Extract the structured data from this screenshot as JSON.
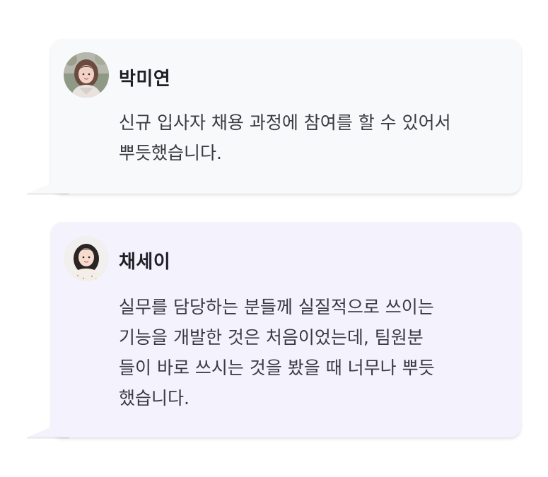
{
  "testimonials": [
    {
      "name": "박미연",
      "lines": [
        "신규 입사자 채용 과정에 참여를 할 수 있어서",
        "뿌듯했습니다."
      ],
      "background": "#f8f9fb"
    },
    {
      "name": "채세이",
      "lines": [
        "실무를 담당하는 분들께 실질적으로 쓰이는",
        "기능을 개발한 것은 처음이었는데, 팀원분",
        "들이 바로 쓰시는 것을 봤을 때 너무나 뿌듯",
        "했습니다."
      ],
      "background": "#f4f2fd"
    }
  ],
  "icons": {
    "avatar_1": "avatar-photo-icon",
    "avatar_2": "avatar-photo-icon"
  }
}
